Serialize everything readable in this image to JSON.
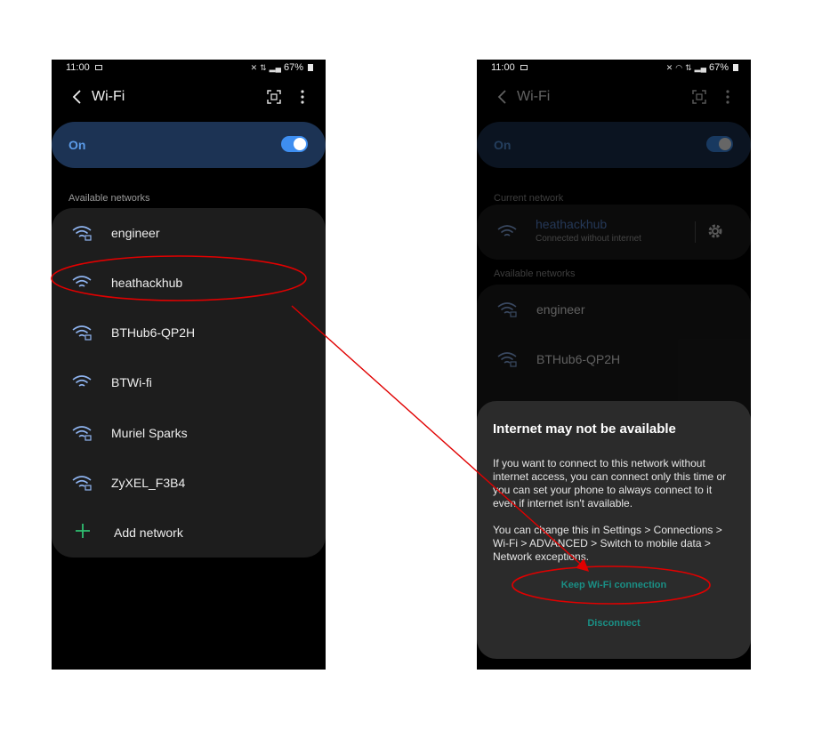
{
  "left_phone": {
    "status": {
      "time": "11:00",
      "battery": "67%"
    },
    "title": "Wi-Fi",
    "toggle": {
      "label": "On",
      "on": true
    },
    "section_available": "Available networks",
    "networks": [
      {
        "name": "engineer",
        "icon": "wifi-lock-icon"
      },
      {
        "name": "heathackhub",
        "icon": "wifi-icon"
      },
      {
        "name": "BTHub6-QP2H",
        "icon": "wifi-lock-icon"
      },
      {
        "name": "BTWi-fi",
        "icon": "wifi-icon"
      },
      {
        "name": "Muriel Sparks",
        "icon": "wifi-lock-icon"
      },
      {
        "name": "ZyXEL_F3B4",
        "icon": "wifi-lock-icon"
      }
    ],
    "add_network": "Add network"
  },
  "right_phone": {
    "status": {
      "time": "11:00",
      "battery": "67%"
    },
    "title": "Wi-Fi",
    "toggle": {
      "label": "On",
      "on": true
    },
    "section_current": "Current network",
    "current": {
      "name": "heathackhub",
      "status": "Connected without internet"
    },
    "section_available": "Available networks",
    "networks": [
      {
        "name": "engineer",
        "icon": "wifi-lock-icon"
      },
      {
        "name": "BTHub6-QP2H",
        "icon": "wifi-lock-icon"
      }
    ],
    "dialog": {
      "title": "Internet may not be available",
      "body": "If you want to connect to this network without internet access, you can connect only this time or you can set your phone to always connect to it even if internet isn't available.",
      "body2": "You can change this in Settings > Connections > Wi-Fi > ADVANCED > Switch to mobile data > Network exceptions.",
      "keep_button": "Keep Wi-Fi connection",
      "disconnect_button": "Disconnect"
    }
  },
  "colors": {
    "accent_blue": "#3e8ef0",
    "toggle_card": "#1c3354",
    "dialog_button": "#1a8f85",
    "annotation_red": "#e00000"
  }
}
